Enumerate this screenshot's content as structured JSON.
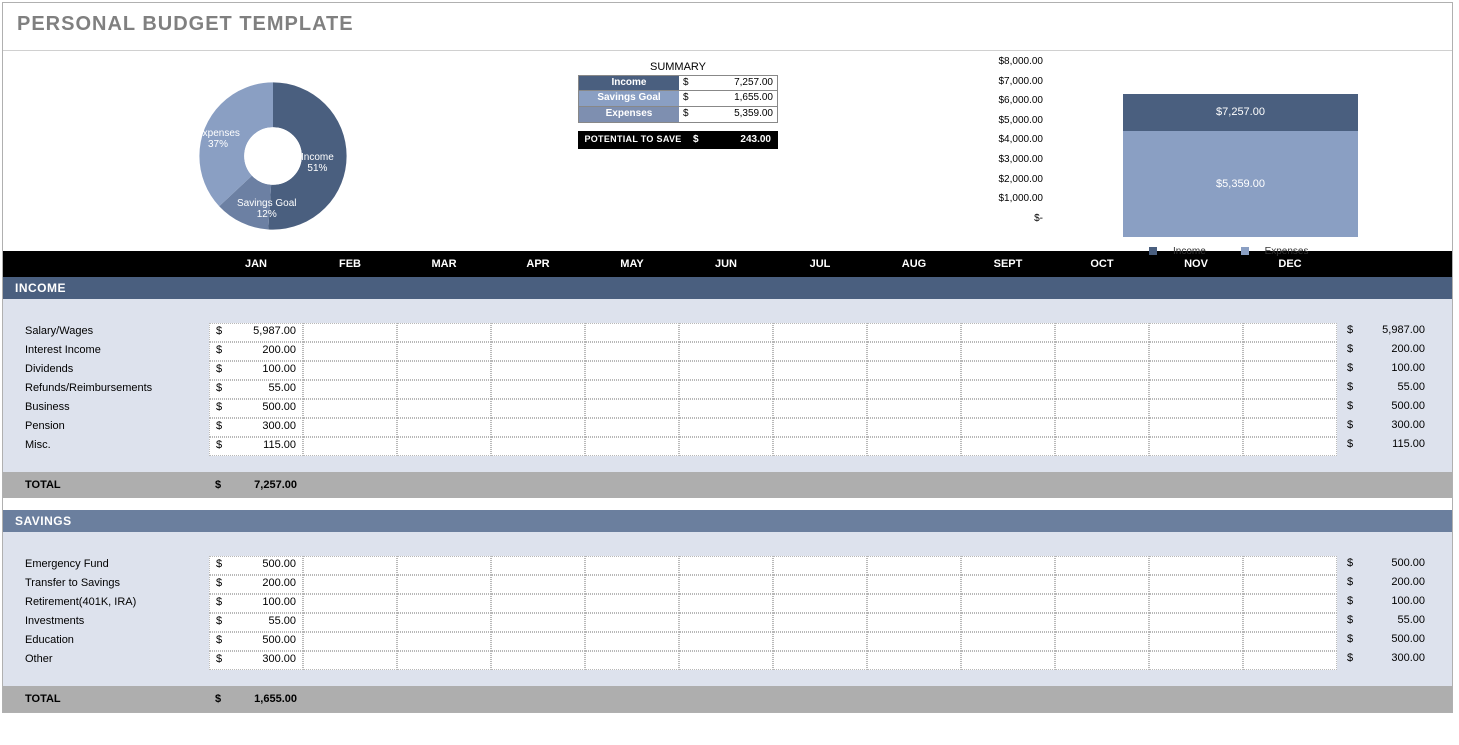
{
  "title": "PERSONAL BUDGET TEMPLATE",
  "summary": {
    "heading": "SUMMARY",
    "rows": [
      {
        "label": "Income",
        "value": "7,257.00",
        "color": "#4a5f7f"
      },
      {
        "label": "Savings Goal",
        "value": "1,655.00",
        "color": "#8a9fc3"
      },
      {
        "label": "Expenses",
        "value": "5,359.00",
        "color": "#7e8fb0"
      }
    ],
    "potential_label": "POTENTIAL TO SAVE",
    "potential_value": "243.00"
  },
  "donut": {
    "segments": [
      {
        "label": "Income",
        "pct": "51%",
        "color": "#4a5f7f"
      },
      {
        "label": "Expenses",
        "pct": "37%",
        "color": "#8a9fc3"
      },
      {
        "label": "Savings Goal",
        "pct": "12%",
        "color": "#6c80a3"
      }
    ]
  },
  "chart_data": {
    "type": "bar",
    "categories": [
      "Income",
      "Expenses"
    ],
    "values": [
      7257.0,
      5359.0
    ],
    "ylim": [
      0,
      8000
    ],
    "yticks": [
      "$8,000.00",
      "$7,000.00",
      "$6,000.00",
      "$5,000.00",
      "$4,000.00",
      "$3,000.00",
      "$2,000.00",
      "$1,000.00",
      "$-"
    ],
    "legend": [
      "Income",
      "Expenses"
    ],
    "data_labels": [
      "$7,257.00",
      "$5,359.00"
    ]
  },
  "months": [
    "JAN",
    "FEB",
    "MAR",
    "APR",
    "MAY",
    "JUN",
    "JUL",
    "AUG",
    "SEPT",
    "OCT",
    "NOV",
    "DEC"
  ],
  "sections": [
    {
      "name": "INCOME",
      "color": "#4a5f7f",
      "rows": [
        {
          "label": "Salary/Wages",
          "jan": "5,987.00",
          "total": "5,987.00"
        },
        {
          "label": "Interest Income",
          "jan": "200.00",
          "total": "200.00"
        },
        {
          "label": "Dividends",
          "jan": "100.00",
          "total": "100.00"
        },
        {
          "label": "Refunds/Reimbursements",
          "jan": "55.00",
          "total": "55.00"
        },
        {
          "label": "Business",
          "jan": "500.00",
          "total": "500.00"
        },
        {
          "label": "Pension",
          "jan": "300.00",
          "total": "300.00"
        },
        {
          "label": "Misc.",
          "jan": "115.00",
          "total": "115.00"
        }
      ],
      "total_label": "TOTAL",
      "total_value": "7,257.00"
    },
    {
      "name": "SAVINGS",
      "color": "#6b7f9e",
      "rows": [
        {
          "label": "Emergency Fund",
          "jan": "500.00",
          "total": "500.00"
        },
        {
          "label": "Transfer to Savings",
          "jan": "200.00",
          "total": "200.00"
        },
        {
          "label": "Retirement(401K, IRA)",
          "jan": "100.00",
          "total": "100.00"
        },
        {
          "label": "Investments",
          "jan": "55.00",
          "total": "55.00"
        },
        {
          "label": "Education",
          "jan": "500.00",
          "total": "500.00"
        },
        {
          "label": "Other",
          "jan": "300.00",
          "total": "300.00"
        }
      ],
      "total_label": "TOTAL",
      "total_value": "1,655.00"
    }
  ]
}
